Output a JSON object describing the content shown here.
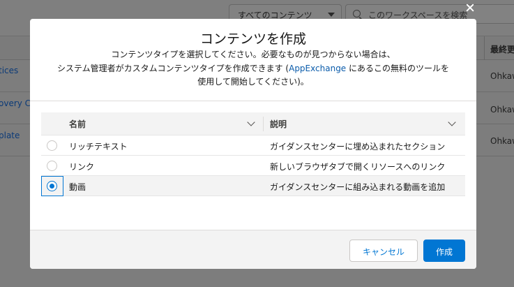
{
  "background": {
    "content_filter": "すべてのコンテンツ",
    "search_placeholder": "このワークスペースを検索",
    "column_last_modified": "最終更",
    "rows": [
      {
        "name": "tices",
        "owner": "Ohkaw"
      },
      {
        "name": "overy Ca",
        "owner": "Ohkaw"
      },
      {
        "name": "plate",
        "owner": "Ohkaw"
      }
    ]
  },
  "modal": {
    "title": "コンテンツを作成",
    "description_line1": "コンテンツタイプを選択してください。必要なものが見つからない場合は、",
    "description_line2_pre": "システム管理者がカスタムコンテンツタイプを作成できます (",
    "description_link": "AppExchange",
    "description_line2_post": " にあるこの無料のツールを",
    "description_line3": "使用して開始してください)。",
    "table": {
      "col_name": "名前",
      "col_desc": "説明",
      "rows": [
        {
          "name": "リッチテキスト",
          "desc": "ガイダンスセンターに埋め込まれたセクション",
          "selected": false
        },
        {
          "name": "リンク",
          "desc": "新しいブラウザタブで開くリソースへのリンク",
          "selected": false
        },
        {
          "name": "動画",
          "desc": "ガイダンスセンターに組み込まれる動画を追加",
          "selected": true
        }
      ]
    },
    "cancel_label": "キャンセル",
    "create_label": "作成"
  },
  "colors": {
    "accent": "#0176d3",
    "link": "#0b5cab"
  }
}
